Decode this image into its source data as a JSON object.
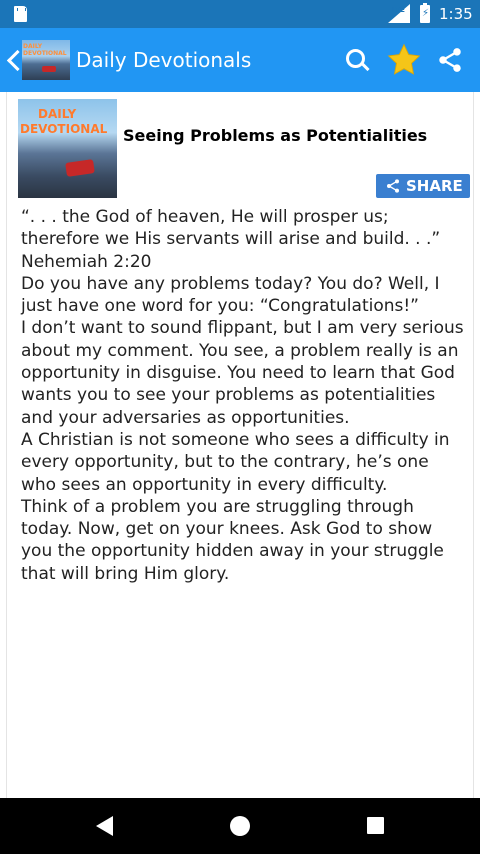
{
  "status_bar": {
    "time": "1:35",
    "network": "LTE",
    "battery_icon": "battery-icon",
    "signal_icon": "signal-icon",
    "sd_icon": "sd-card-icon"
  },
  "app_bar": {
    "title": "Daily Devotionals",
    "logo_text": "DAILY DEVOTIONAL",
    "back_icon": "back-arrow-icon",
    "search_icon": "search-icon",
    "favorite_icon": "star-icon",
    "share_icon": "share-icon",
    "star_color": "#f5c518",
    "bar_color": "#2196f3"
  },
  "article": {
    "thumb_line1": "DAILY",
    "thumb_line2": "DEVOTIONAL",
    "title": "Seeing Problems as Potentialities",
    "share_label": "SHARE",
    "share_button_color": "#3a7fd0",
    "paragraphs": [
      "“. . . the God of heaven, He will prosper us; therefore we His servants will arise and build. . .” Nehemiah 2:20",
      "Do you have any problems today? You do? Well, I just have one word for you: “Congratulations!”",
      "I don’t want to sound flippant, but I am very serious about my comment. You see, a problem really is an opportunity in disguise. You need to learn that God wants you to see your problems as potentialities and your adversaries as opportunities.",
      "A Christian is not someone who sees a difficulty in every opportunity, but to the contrary, he’s one who sees an opportunity in every difficulty.",
      "Think of a problem you are struggling through today. Now, get on your knees. Ask God to show you the opportunity hidden away in your struggle that will bring Him glory."
    ]
  },
  "nav_bar": {
    "back_icon": "nav-back-icon",
    "home_icon": "nav-home-icon",
    "recents_icon": "nav-recents-icon"
  }
}
